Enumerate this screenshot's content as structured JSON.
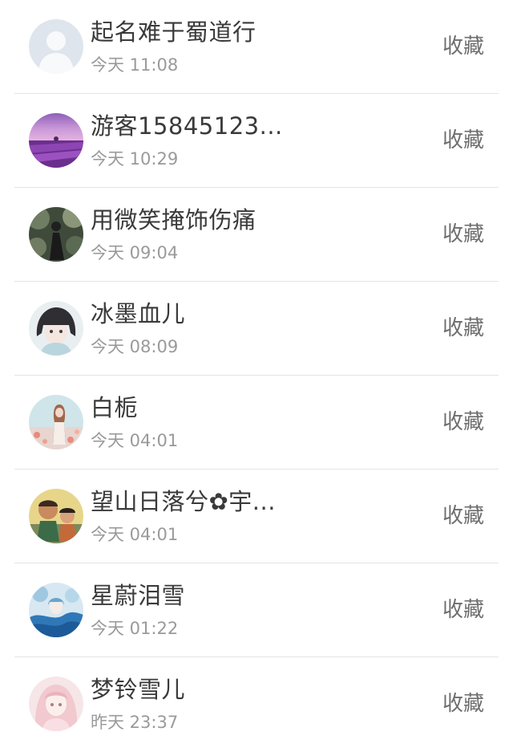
{
  "list": {
    "action_label": "收藏",
    "items": [
      {
        "name": "起名难于蜀道行",
        "time": "今天 11:08",
        "avatar": "default-person-avatar"
      },
      {
        "name": "游客15845123...",
        "time": "今天 10:29",
        "avatar": "lavender-field-avatar"
      },
      {
        "name": "用微笑掩饰伤痛",
        "time": "今天 09:04",
        "avatar": "girl-in-garden-avatar"
      },
      {
        "name": "冰墨血儿",
        "time": "今天 08:09",
        "avatar": "anime-girl-avatar"
      },
      {
        "name": "白栀",
        "time": "今天 04:01",
        "avatar": "girl-with-flowers-avatar"
      },
      {
        "name": "望山日落兮✿宇...",
        "time": "今天 04:01",
        "avatar": "cartoon-boys-avatar"
      },
      {
        "name": "星蔚泪雪",
        "time": "今天 01:22",
        "avatar": "blue-anime-avatar"
      },
      {
        "name": "梦铃雪儿",
        "time": "昨天 23:37",
        "avatar": "pink-anime-girl-avatar"
      }
    ]
  }
}
